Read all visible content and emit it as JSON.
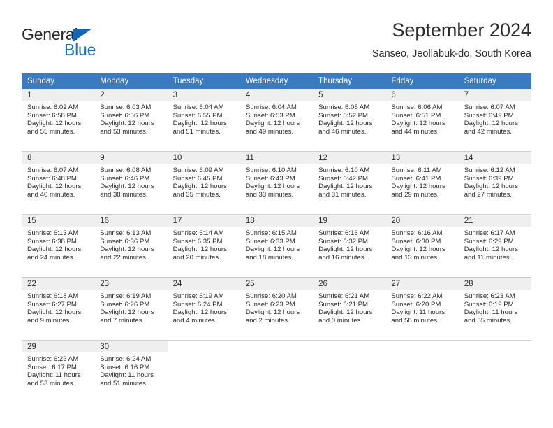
{
  "logo": {
    "word1": "General",
    "word2": "Blue",
    "triangle_color": "#1565b5",
    "blue_color": "#1874c4",
    "dark_color": "#2b2b2b"
  },
  "header": {
    "title": "September 2024",
    "subtitle": "Sanseo, Jeollabuk-do, South Korea"
  },
  "calendar": {
    "header_bg": "#3a7ac0",
    "daynum_bg": "#efefef",
    "weekdays": [
      "Sunday",
      "Monday",
      "Tuesday",
      "Wednesday",
      "Thursday",
      "Friday",
      "Saturday"
    ],
    "weeks": [
      [
        {
          "day": "1",
          "sunrise": "Sunrise: 6:02 AM",
          "sunset": "Sunset: 6:58 PM",
          "daylight1": "Daylight: 12 hours",
          "daylight2": "and 55 minutes."
        },
        {
          "day": "2",
          "sunrise": "Sunrise: 6:03 AM",
          "sunset": "Sunset: 6:56 PM",
          "daylight1": "Daylight: 12 hours",
          "daylight2": "and 53 minutes."
        },
        {
          "day": "3",
          "sunrise": "Sunrise: 6:04 AM",
          "sunset": "Sunset: 6:55 PM",
          "daylight1": "Daylight: 12 hours",
          "daylight2": "and 51 minutes."
        },
        {
          "day": "4",
          "sunrise": "Sunrise: 6:04 AM",
          "sunset": "Sunset: 6:53 PM",
          "daylight1": "Daylight: 12 hours",
          "daylight2": "and 49 minutes."
        },
        {
          "day": "5",
          "sunrise": "Sunrise: 6:05 AM",
          "sunset": "Sunset: 6:52 PM",
          "daylight1": "Daylight: 12 hours",
          "daylight2": "and 46 minutes."
        },
        {
          "day": "6",
          "sunrise": "Sunrise: 6:06 AM",
          "sunset": "Sunset: 6:51 PM",
          "daylight1": "Daylight: 12 hours",
          "daylight2": "and 44 minutes."
        },
        {
          "day": "7",
          "sunrise": "Sunrise: 6:07 AM",
          "sunset": "Sunset: 6:49 PM",
          "daylight1": "Daylight: 12 hours",
          "daylight2": "and 42 minutes."
        }
      ],
      [
        {
          "day": "8",
          "sunrise": "Sunrise: 6:07 AM",
          "sunset": "Sunset: 6:48 PM",
          "daylight1": "Daylight: 12 hours",
          "daylight2": "and 40 minutes."
        },
        {
          "day": "9",
          "sunrise": "Sunrise: 6:08 AM",
          "sunset": "Sunset: 6:46 PM",
          "daylight1": "Daylight: 12 hours",
          "daylight2": "and 38 minutes."
        },
        {
          "day": "10",
          "sunrise": "Sunrise: 6:09 AM",
          "sunset": "Sunset: 6:45 PM",
          "daylight1": "Daylight: 12 hours",
          "daylight2": "and 35 minutes."
        },
        {
          "day": "11",
          "sunrise": "Sunrise: 6:10 AM",
          "sunset": "Sunset: 6:43 PM",
          "daylight1": "Daylight: 12 hours",
          "daylight2": "and 33 minutes."
        },
        {
          "day": "12",
          "sunrise": "Sunrise: 6:10 AM",
          "sunset": "Sunset: 6:42 PM",
          "daylight1": "Daylight: 12 hours",
          "daylight2": "and 31 minutes."
        },
        {
          "day": "13",
          "sunrise": "Sunrise: 6:11 AM",
          "sunset": "Sunset: 6:41 PM",
          "daylight1": "Daylight: 12 hours",
          "daylight2": "and 29 minutes."
        },
        {
          "day": "14",
          "sunrise": "Sunrise: 6:12 AM",
          "sunset": "Sunset: 6:39 PM",
          "daylight1": "Daylight: 12 hours",
          "daylight2": "and 27 minutes."
        }
      ],
      [
        {
          "day": "15",
          "sunrise": "Sunrise: 6:13 AM",
          "sunset": "Sunset: 6:38 PM",
          "daylight1": "Daylight: 12 hours",
          "daylight2": "and 24 minutes."
        },
        {
          "day": "16",
          "sunrise": "Sunrise: 6:13 AM",
          "sunset": "Sunset: 6:36 PM",
          "daylight1": "Daylight: 12 hours",
          "daylight2": "and 22 minutes."
        },
        {
          "day": "17",
          "sunrise": "Sunrise: 6:14 AM",
          "sunset": "Sunset: 6:35 PM",
          "daylight1": "Daylight: 12 hours",
          "daylight2": "and 20 minutes."
        },
        {
          "day": "18",
          "sunrise": "Sunrise: 6:15 AM",
          "sunset": "Sunset: 6:33 PM",
          "daylight1": "Daylight: 12 hours",
          "daylight2": "and 18 minutes."
        },
        {
          "day": "19",
          "sunrise": "Sunrise: 6:16 AM",
          "sunset": "Sunset: 6:32 PM",
          "daylight1": "Daylight: 12 hours",
          "daylight2": "and 16 minutes."
        },
        {
          "day": "20",
          "sunrise": "Sunrise: 6:16 AM",
          "sunset": "Sunset: 6:30 PM",
          "daylight1": "Daylight: 12 hours",
          "daylight2": "and 13 minutes."
        },
        {
          "day": "21",
          "sunrise": "Sunrise: 6:17 AM",
          "sunset": "Sunset: 6:29 PM",
          "daylight1": "Daylight: 12 hours",
          "daylight2": "and 11 minutes."
        }
      ],
      [
        {
          "day": "22",
          "sunrise": "Sunrise: 6:18 AM",
          "sunset": "Sunset: 6:27 PM",
          "daylight1": "Daylight: 12 hours",
          "daylight2": "and 9 minutes."
        },
        {
          "day": "23",
          "sunrise": "Sunrise: 6:19 AM",
          "sunset": "Sunset: 6:26 PM",
          "daylight1": "Daylight: 12 hours",
          "daylight2": "and 7 minutes."
        },
        {
          "day": "24",
          "sunrise": "Sunrise: 6:19 AM",
          "sunset": "Sunset: 6:24 PM",
          "daylight1": "Daylight: 12 hours",
          "daylight2": "and 4 minutes."
        },
        {
          "day": "25",
          "sunrise": "Sunrise: 6:20 AM",
          "sunset": "Sunset: 6:23 PM",
          "daylight1": "Daylight: 12 hours",
          "daylight2": "and 2 minutes."
        },
        {
          "day": "26",
          "sunrise": "Sunrise: 6:21 AM",
          "sunset": "Sunset: 6:21 PM",
          "daylight1": "Daylight: 12 hours",
          "daylight2": "and 0 minutes."
        },
        {
          "day": "27",
          "sunrise": "Sunrise: 6:22 AM",
          "sunset": "Sunset: 6:20 PM",
          "daylight1": "Daylight: 11 hours",
          "daylight2": "and 58 minutes."
        },
        {
          "day": "28",
          "sunrise": "Sunrise: 6:23 AM",
          "sunset": "Sunset: 6:19 PM",
          "daylight1": "Daylight: 11 hours",
          "daylight2": "and 55 minutes."
        }
      ],
      [
        {
          "day": "29",
          "sunrise": "Sunrise: 6:23 AM",
          "sunset": "Sunset: 6:17 PM",
          "daylight1": "Daylight: 11 hours",
          "daylight2": "and 53 minutes."
        },
        {
          "day": "30",
          "sunrise": "Sunrise: 6:24 AM",
          "sunset": "Sunset: 6:16 PM",
          "daylight1": "Daylight: 11 hours",
          "daylight2": "and 51 minutes."
        },
        {
          "day": "",
          "sunrise": "",
          "sunset": "",
          "daylight1": "",
          "daylight2": ""
        },
        {
          "day": "",
          "sunrise": "",
          "sunset": "",
          "daylight1": "",
          "daylight2": ""
        },
        {
          "day": "",
          "sunrise": "",
          "sunset": "",
          "daylight1": "",
          "daylight2": ""
        },
        {
          "day": "",
          "sunrise": "",
          "sunset": "",
          "daylight1": "",
          "daylight2": ""
        },
        {
          "day": "",
          "sunrise": "",
          "sunset": "",
          "daylight1": "",
          "daylight2": ""
        }
      ]
    ]
  }
}
